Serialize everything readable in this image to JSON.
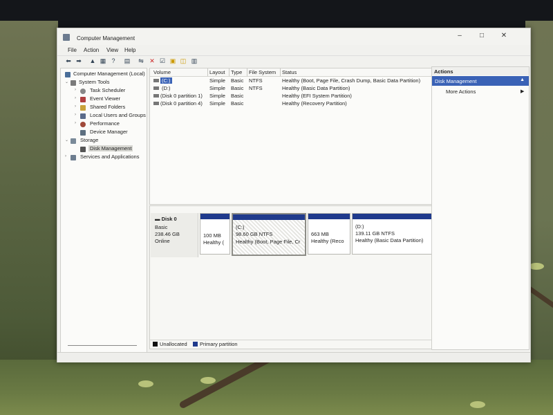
{
  "window": {
    "title": "Computer Management",
    "controls": {
      "minimize": "–",
      "maximize": "□",
      "close": "✕"
    }
  },
  "menu": [
    "File",
    "Action",
    "View",
    "Help"
  ],
  "toolbar_icons": [
    "back-arrow-icon",
    "forward-arrow-icon",
    "up-folder-icon",
    "show-tree-icon",
    "help-icon",
    "connect-icon",
    "delete-icon",
    "properties-icon",
    "refresh-icon",
    "export-icon",
    "view-icon"
  ],
  "tree": {
    "root": "Computer Management (Local)",
    "system_tools": "System Tools",
    "items": [
      "Task Scheduler",
      "Event Viewer",
      "Shared Folders",
      "Local Users and Groups",
      "Performance",
      "Device Manager"
    ],
    "storage": "Storage",
    "disk_management": "Disk Management",
    "services": "Services and Applications"
  },
  "volumes": {
    "columns": [
      "Volume",
      "Layout",
      "Type",
      "File System",
      "Status"
    ],
    "rows": [
      {
        "volume": "(C:)",
        "layout": "Simple",
        "type": "Basic",
        "fs": "NTFS",
        "status": "Healthy (Boot, Page File, Crash Dump, Basic Data Partition)"
      },
      {
        "volume": "(D:)",
        "layout": "Simple",
        "type": "Basic",
        "fs": "NTFS",
        "status": "Healthy (Basic Data Partition)"
      },
      {
        "volume": "(Disk 0 partition 1)",
        "layout": "Simple",
        "type": "Basic",
        "fs": "",
        "status": "Healthy (EFI System Partition)"
      },
      {
        "volume": "(Disk 0 partition 4)",
        "layout": "Simple",
        "type": "Basic",
        "fs": "",
        "status": "Healthy (Recovery Partition)"
      }
    ]
  },
  "disk": {
    "name": "Disk 0",
    "type": "Basic",
    "size": "238.46 GB",
    "state": "Online",
    "partitions": [
      {
        "label": "",
        "size": "100 MB",
        "status": "Healthy ("
      },
      {
        "label": "(C:)",
        "size": "98.60 GB NTFS",
        "status": "Healthy (Boot, Page File, Cr"
      },
      {
        "label": "",
        "size": "663 MB",
        "status": "Healthy (Reco"
      },
      {
        "label": "(D:)",
        "size": "139.11 GB NTFS",
        "status": "Healthy (Basic Data Partition)"
      }
    ]
  },
  "legend": {
    "unallocated": "Unallocated",
    "primary": "Primary partition",
    "unallocated_color": "#111111",
    "primary_color": "#1f3a8c"
  },
  "actions": {
    "header": "Actions",
    "section": "Disk Management",
    "more": "More Actions"
  },
  "colors": {
    "selection": "#3a62b6",
    "partition_bar": "#1f3a8c"
  }
}
